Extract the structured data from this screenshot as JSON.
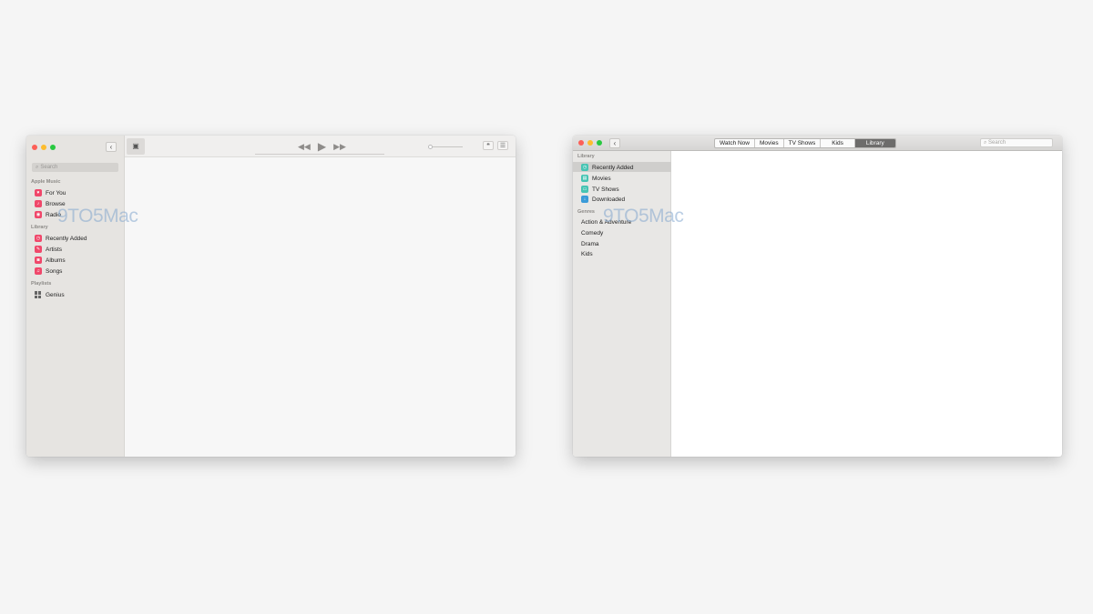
{
  "music_window": {
    "search_placeholder": "Search",
    "sections": [
      {
        "title": "Apple Music",
        "items": [
          {
            "label": "For You"
          },
          {
            "label": "Browse"
          },
          {
            "label": "Radio"
          }
        ]
      },
      {
        "title": "Library",
        "items": [
          {
            "label": "Recently Added"
          },
          {
            "label": "Artists"
          },
          {
            "label": "Albums"
          },
          {
            "label": "Songs"
          }
        ]
      },
      {
        "title": "Playlists",
        "items": [
          {
            "label": "Genius"
          }
        ]
      }
    ]
  },
  "tv_window": {
    "tabs": [
      "Watch Now",
      "Movies",
      "TV Shows",
      "Kids",
      "Library"
    ],
    "selected_tab": "Library",
    "search_placeholder": "Search",
    "library_title": "Library",
    "library_items": [
      "Recently Added",
      "Movies",
      "TV Shows",
      "Downloaded"
    ],
    "genres_title": "Genres",
    "genres": [
      "Action & Adventure",
      "Comedy",
      "Drama",
      "Kids"
    ]
  },
  "watermark": "9TO5Mac"
}
